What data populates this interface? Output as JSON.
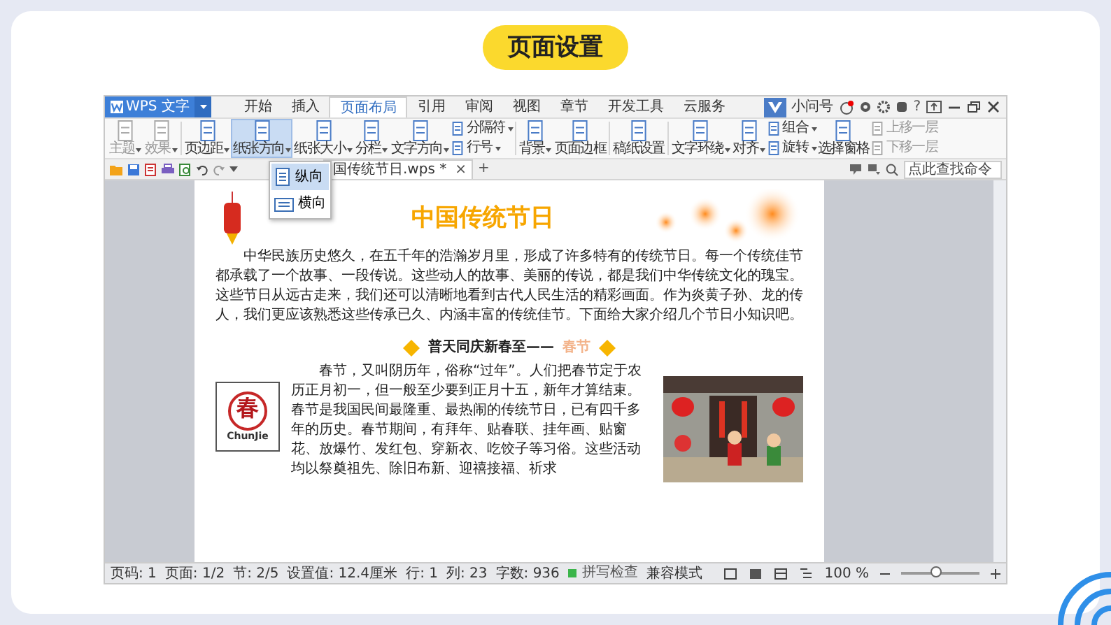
{
  "slide_title": "页面设置",
  "app": {
    "app_menu": "WPS 文字",
    "tabs": [
      {
        "label": "开始",
        "selected": false
      },
      {
        "label": "插入",
        "selected": false
      },
      {
        "label": "页面布局",
        "selected": true
      },
      {
        "label": "引用",
        "selected": false
      },
      {
        "label": "审阅",
        "selected": false
      },
      {
        "label": "视图",
        "selected": false
      },
      {
        "label": "章节",
        "selected": false
      },
      {
        "label": "开发工具",
        "selected": false
      },
      {
        "label": "云服务",
        "selected": false
      }
    ],
    "user": "小问号",
    "help": "?",
    "ribbon": [
      {
        "items": [
          {
            "kind": "large",
            "label": "主题",
            "dropdown": true,
            "disabled": true,
            "open": false
          },
          {
            "kind": "large",
            "label": "效果",
            "dropdown": true,
            "disabled": true,
            "open": false
          }
        ]
      },
      {
        "items": [
          {
            "kind": "large",
            "label": "页边距",
            "dropdown": true,
            "disabled": false,
            "open": false
          },
          {
            "kind": "large",
            "label": "纸张方向",
            "dropdown": true,
            "disabled": false,
            "open": true
          },
          {
            "kind": "large",
            "label": "纸张大小",
            "dropdown": true,
            "disabled": false,
            "open": false
          },
          {
            "kind": "large",
            "label": "分栏",
            "dropdown": true,
            "disabled": false,
            "open": false
          },
          {
            "kind": "large",
            "label": "文字方向",
            "dropdown": true,
            "disabled": false,
            "open": false
          },
          {
            "kind": "pair",
            "items": [
              {
                "label": "分隔符",
                "dropdown": true,
                "disabled": false
              },
              {
                "label": "行号",
                "dropdown": true,
                "disabled": false
              }
            ]
          }
        ]
      },
      {
        "items": [
          {
            "kind": "large",
            "label": "背景",
            "dropdown": true,
            "disabled": false,
            "open": false
          },
          {
            "kind": "large",
            "label": "页面边框",
            "dropdown": false,
            "disabled": false,
            "open": false
          }
        ]
      },
      {
        "items": [
          {
            "kind": "large",
            "label": "稿纸设置",
            "dropdown": false,
            "disabled": false,
            "open": false
          }
        ]
      },
      {
        "items": [
          {
            "kind": "large",
            "label": "文字环绕",
            "dropdown": true,
            "disabled": false,
            "open": false
          },
          {
            "kind": "large",
            "label": "对齐",
            "dropdown": true,
            "disabled": false,
            "open": false
          },
          {
            "kind": "pair",
            "items": [
              {
                "label": "组合",
                "dropdown": true,
                "disabled": false
              },
              {
                "label": "旋转",
                "dropdown": true,
                "disabled": false
              }
            ]
          },
          {
            "kind": "large",
            "label": "选择窗格",
            "dropdown": false,
            "disabled": false,
            "open": false
          },
          {
            "kind": "pair",
            "items": [
              {
                "label": "上移一层",
                "dropdown": false,
                "disabled": true
              },
              {
                "label": "下移一层",
                "dropdown": false,
                "disabled": true
              }
            ]
          }
        ]
      }
    ],
    "document_tab": {
      "label": "国传统节日.wps *",
      "close": "×"
    },
    "new_tab": "+",
    "search": {
      "placeholder": "点此查找命令"
    },
    "orientation_menu": [
      {
        "label": "纵向",
        "kind": "portrait",
        "selected": true
      },
      {
        "label": "横向",
        "kind": "landscape",
        "selected": false
      }
    ],
    "document": {
      "heading": "中国传统节日",
      "intro": "中华民族历史悠久，在五千年的浩瀚岁月里，形成了许多特有的传统节日。每一个传统佳节都承载了一个故事、一段传说。这些动人的故事、美丽的传说，都是我们中华传统文化的瑰宝。这些节日从远古走来，我们还可以清晰地看到古代人民生活的精彩画面。作为炎黄子孙、龙的传人，我们更应该熟悉这些传承已久、内涵丰富的传统佳节。下面给大家介绍几个节日小知识吧。",
      "section": {
        "lead": "普天同庆新春至——",
        "name": "春节"
      },
      "logo": {
        "character": "春",
        "caption": "ChunJie"
      },
      "body": "春节，又叫阴历年，俗称“过年”。人们把春节定于农历正月初一，但一般至少要到正月十五，新年才算结束。春节是我国民间最隆重、最热闹的传统节日，已有四千多年的历史。春节期间，有拜年、贴春联、挂年画、贴窗花、放爆竹、发红包、穿新衣、吃饺子等习俗。这些活动均以祭奠祖先、除旧布新、迎禧接福、祈求"
    },
    "status_bar": {
      "items": [
        "页码: 1",
        "页面: 1/2",
        "节: 2/5",
        "设置值: 12.4厘米",
        "行: 1",
        "列: 23",
        "字数: 936"
      ],
      "spell_check": "拼写检查",
      "mode": "兼容模式",
      "zoom": "100 %",
      "zoom_slider": {
        "level": 0.45
      }
    }
  }
}
